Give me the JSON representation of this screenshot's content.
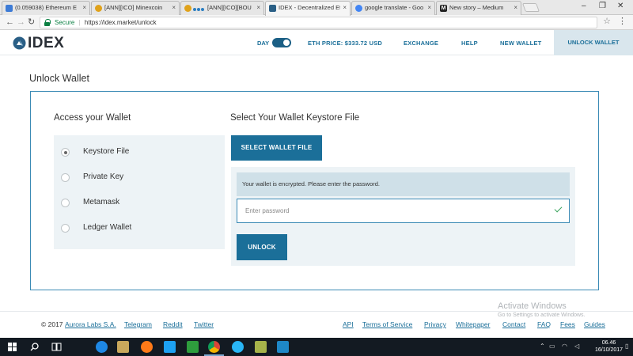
{
  "browser": {
    "tabs": [
      {
        "title": "(0.059038) Ethereum ET",
        "color": "#3d7bd6",
        "active": false
      },
      {
        "title": "[ANN][ICO] Minexcoin",
        "color": "#e0a21b",
        "active": false
      },
      {
        "title": "[ANN][ICO][BOU",
        "color": "#e0a21b",
        "active": false
      },
      {
        "title": "IDEX - Decentralized Et",
        "color": "#2a5f86",
        "active": true
      },
      {
        "title": "google translate - Goo",
        "color": "#4285f4",
        "active": false
      },
      {
        "title": "New story – Medium",
        "color": "#222222",
        "active": false
      }
    ],
    "secure_label": "Secure",
    "url": "https://idex.market/unlock",
    "back_icon": "back-arrow-icon",
    "forward_icon": "forward-arrow-icon",
    "reload_icon": "reload-icon"
  },
  "header": {
    "logo_text": "IDEX",
    "day_label": "DAY",
    "eth_price": "ETH PRICE: $333.72 USD",
    "nav": [
      "EXCHANGE",
      "HELP",
      "NEW WALLET"
    ],
    "active_nav": "UNLOCK WALLET",
    "accent": "#1b6f99"
  },
  "page": {
    "title": "Unlock Wallet",
    "access_title": "Access your Wallet",
    "options": [
      {
        "label": "Keystore File",
        "selected": true
      },
      {
        "label": "Private Key",
        "selected": false
      },
      {
        "label": "Metamask",
        "selected": false
      },
      {
        "label": "Ledger Wallet",
        "selected": false
      }
    ],
    "keystore_title": "Select Your Wallet Keystore File",
    "select_button": "SELECT WALLET FILE",
    "notice": "Your wallet is encrypted. Please enter the password.",
    "password_placeholder": "Enter password",
    "password_value": "",
    "unlock_button": "UNLOCK"
  },
  "footer": {
    "copyright": "© 2017",
    "company": "Aurora Labs S.A.",
    "social": [
      "Telegram",
      "Reddit",
      "Twitter"
    ],
    "links": [
      "API",
      "Terms of Service",
      "Privacy",
      "Whitepaper",
      "Contact",
      "FAQ",
      "Fees",
      "Guides"
    ]
  },
  "watermark": {
    "line1": "Activate Windows",
    "line2": "Go to Settings to activate Windows."
  },
  "taskbar": {
    "time": "06.46",
    "date": "16/10/2017"
  }
}
